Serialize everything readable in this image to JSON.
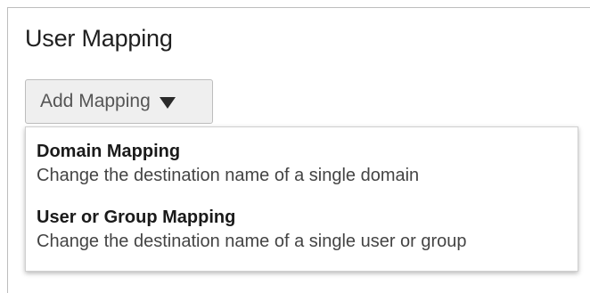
{
  "page": {
    "title": "User Mapping"
  },
  "add_mapping": {
    "label": "Add Mapping",
    "icon": "caret-down-icon"
  },
  "menu": {
    "items": [
      {
        "title": "Domain Mapping",
        "description": "Change the destination name of a single domain"
      },
      {
        "title": "User or Group Mapping",
        "description": "Change the destination name of a single user or group"
      }
    ]
  },
  "colors": {
    "button_bg": "#efefef",
    "border": "#bdbdbd",
    "text": "#1f1f1f"
  }
}
